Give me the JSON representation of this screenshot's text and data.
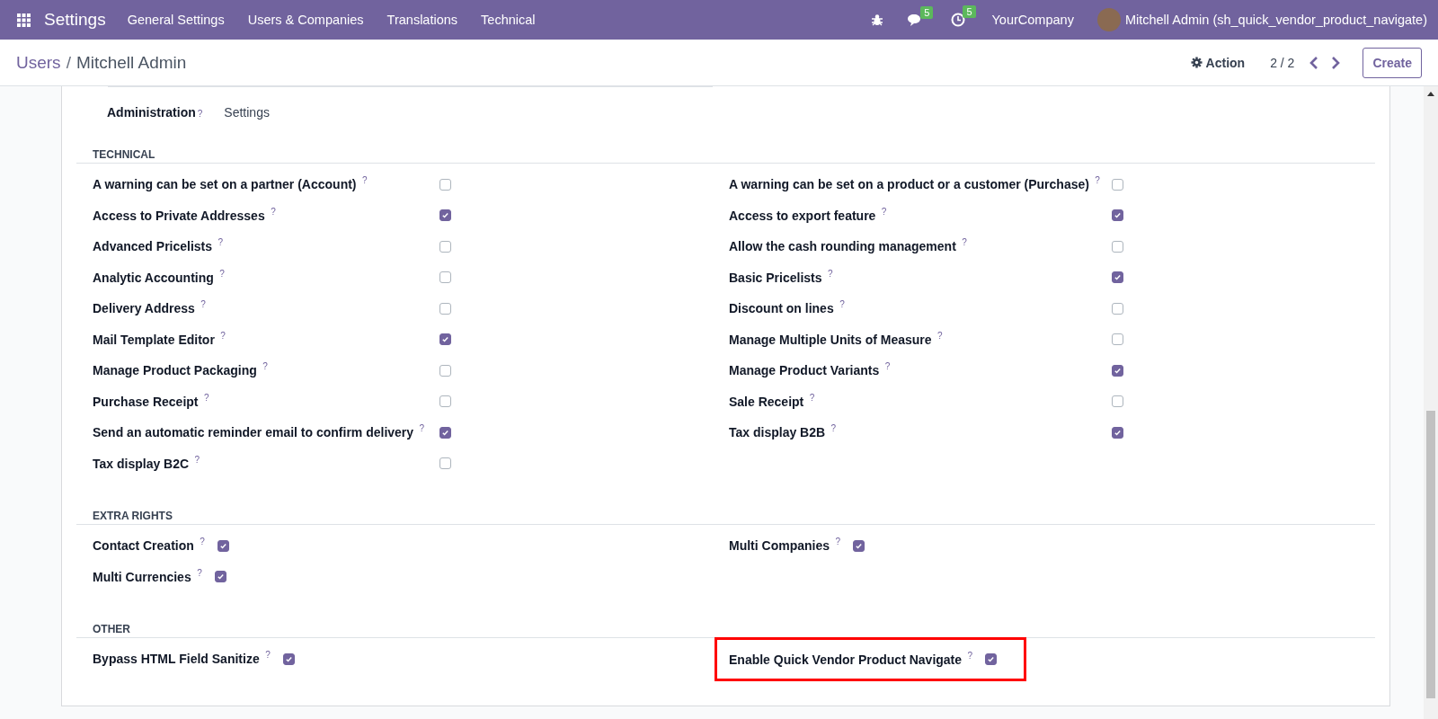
{
  "navbar": {
    "app_name": "Settings",
    "menus": [
      "General Settings",
      "Users & Companies",
      "Translations",
      "Technical"
    ],
    "messages_badge": "5",
    "activities_badge": "5",
    "company": "YourCompany",
    "user": "Mitchell Admin (sh_quick_vendor_product_navigate)"
  },
  "control_panel": {
    "breadcrumb_parent": "Users",
    "breadcrumb_separator": "/",
    "breadcrumb_current": "Mitchell Admin",
    "action": "Action",
    "pager": "2 / 2",
    "create": "Create"
  },
  "administration": {
    "label": "Administration",
    "help": "?",
    "value": "Settings"
  },
  "sections": [
    {
      "title": "TECHNICAL",
      "kind": "wide",
      "columns": [
        [
          {
            "label": "A warning can be set on a partner (Account)",
            "help": "?",
            "checked": false
          },
          {
            "label": "Access to Private Addresses",
            "help": "?",
            "checked": true
          },
          {
            "label": "Advanced Pricelists",
            "help": "?",
            "checked": false
          },
          {
            "label": "Analytic Accounting",
            "help": "?",
            "checked": false
          },
          {
            "label": "Delivery Address",
            "help": "?",
            "checked": false
          },
          {
            "label": "Mail Template Editor",
            "help": "?",
            "checked": true
          },
          {
            "label": "Manage Product Packaging",
            "help": "?",
            "checked": false
          },
          {
            "label": "Purchase Receipt",
            "help": "?",
            "checked": false
          },
          {
            "label": "Send an automatic reminder email to confirm delivery",
            "help": "?",
            "checked": true
          },
          {
            "label": "Tax display B2C",
            "help": "?",
            "checked": false
          }
        ],
        [
          {
            "label": "A warning can be set on a product or a customer (Purchase)",
            "help": "?",
            "checked": false
          },
          {
            "label": "Access to export feature",
            "help": "?",
            "checked": true
          },
          {
            "label": "Allow the cash rounding management",
            "help": "?",
            "checked": false
          },
          {
            "label": "Basic Pricelists",
            "help": "?",
            "checked": true
          },
          {
            "label": "Discount on lines",
            "help": "?",
            "checked": false
          },
          {
            "label": "Manage Multiple Units of Measure",
            "help": "?",
            "checked": false
          },
          {
            "label": "Manage Product Variants",
            "help": "?",
            "checked": true
          },
          {
            "label": "Sale Receipt",
            "help": "?",
            "checked": false
          },
          {
            "label": "Tax display B2B",
            "help": "?",
            "checked": true
          }
        ]
      ]
    },
    {
      "title": "EXTRA RIGHTS",
      "kind": "compact",
      "columns": [
        [
          {
            "label": "Contact Creation",
            "help": "?",
            "checked": true
          },
          {
            "label": "Multi Currencies",
            "help": "?",
            "checked": true
          }
        ],
        [
          {
            "label": "Multi Companies",
            "help": "?",
            "checked": true
          }
        ]
      ]
    },
    {
      "title": "OTHER",
      "kind": "compact",
      "columns": [
        [
          {
            "label": "Bypass HTML Field Sanitize",
            "help": "?",
            "checked": true
          }
        ],
        [
          {
            "label": "Enable Quick Vendor Product Navigate",
            "help": "?",
            "checked": true,
            "highlighted": true
          }
        ]
      ]
    }
  ]
}
